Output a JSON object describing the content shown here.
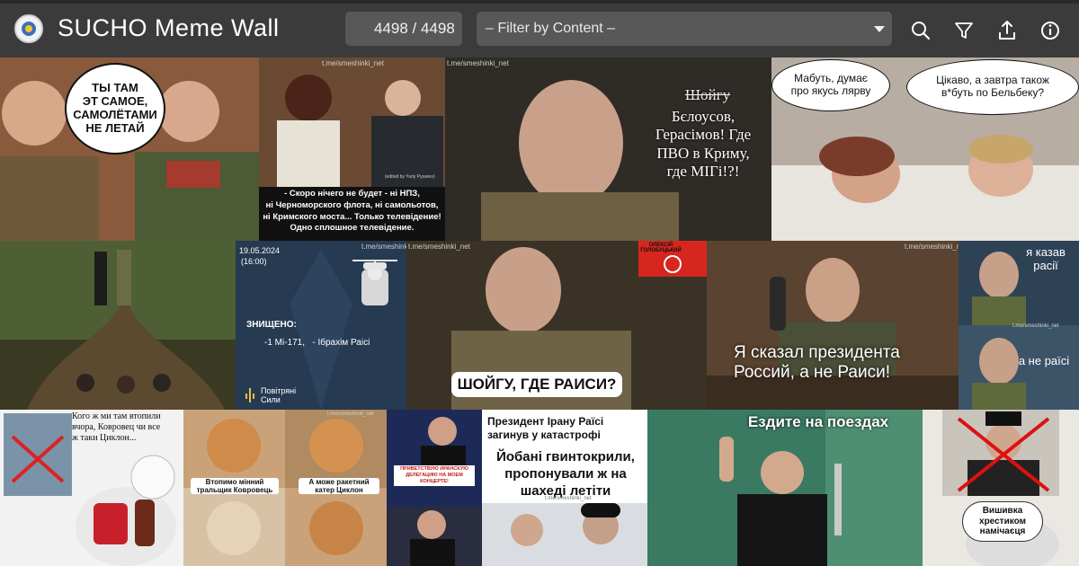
{
  "app": {
    "title": "SUCHO Meme Wall",
    "counter": "4498 / 4498",
    "filter_label": "– Filter by Content –",
    "icons": [
      "search-icon",
      "filter-icon",
      "upload-icon",
      "info-icon"
    ]
  },
  "memes": {
    "m1": {
      "bubble": "ТЫ ТАМ\nЭТ САМОЕ,\nСАМОЛЁТАМИ\nНЕ ЛЕТАЙ"
    },
    "m2": {
      "caption": "- Скоро нічего не будет - ні НПЗ,\nні Черноморского флота, ні самольотов,\nні Кримского моста... Только телевідение!\nОдно сплошное телевідение.",
      "watermark": "t.me/smeshinki_net",
      "credit": "(edited by Yuriy Pysarev)"
    },
    "m3": {
      "strike": "Шойгу",
      "text": "Бєлоусов,\nГерасімов! Где\nПВО в Криму,\nгде МІГі!?!",
      "watermark": "t.me/smeshinki_net"
    },
    "m4": {
      "bubble_left": "Мабуть, думає\nпро якусь лярву",
      "bubble_right": "Цікаво, а завтра також\nв*буть по Бельбеку?"
    },
    "m6": {
      "date": "19.05.2024",
      "time": "(16:00)",
      "header": "ЗНИЩЕНО:",
      "line": "-1 Мі-171,   - Ібрахім Раісі",
      "footer": "Повітряні\nСили",
      "watermark": "t.me/smeshinki_net"
    },
    "m7": {
      "caption": "ШОЙГУ, ГДЕ РАИСИ?",
      "badge": "ОЛЕКСІЙ\nГОЛОБУЦЬКИЙ",
      "watermark": "t.me/smeshinki_net"
    },
    "m8": {
      "caption": "Я сказал президента\nРоссий, а не Раиси!",
      "watermark": "t.me/smeshinki_net"
    },
    "m9": {
      "top": "я казав\nрасії",
      "bottom": "а не раїсі",
      "watermark": "t.me/smeshinki_net"
    },
    "m10": {
      "caption": "Кого ж ми там втопили\nвчора, Ковровец чи все\nж таки Циклон..."
    },
    "m11": {
      "left": "Втопимо мінний\nтральщик Ковровець",
      "right": "А може ракетний\nкатер Циклон",
      "watermark": "t.me/smeshinki_net"
    },
    "m12": {
      "caption": "ПРИВЕТСТВУЮ ИРАНСКУЮ\nДЕЛЕГАЦИЮ НА МОЕМ\nКОНЦЕРТЕ!"
    },
    "m13": {
      "header": "Президент Ірану Раїсі\nзагинув у катастрофі",
      "text": "Йобані гвинтокрили,\nпропонували ж на\nшахеді летіти",
      "watermark": "t.me/smeshinki_net"
    },
    "m14": {
      "caption": "Ездите на поездах"
    },
    "m15": {
      "caption": "Вишивка\nхрестиком\nнамічаєця"
    }
  }
}
